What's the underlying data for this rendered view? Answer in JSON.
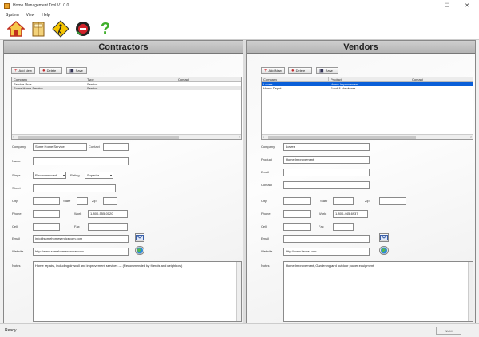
{
  "window": {
    "title": "Home Management Tool V1.0.0",
    "minimize": "–",
    "maximize": "☐",
    "close": "✕"
  },
  "menu": [
    "System",
    "View",
    "Help"
  ],
  "toolbar": {
    "icons": [
      "home-icon",
      "book-icon",
      "construction-sign-icon",
      "no-entry-icon",
      "help-icon"
    ],
    "help_glyph": "?"
  },
  "contractors": {
    "title": "Contractors",
    "buttons": {
      "add": "Add New",
      "delete": "Delete",
      "save": "Save"
    },
    "columns": [
      "Company",
      "Type",
      "Contact"
    ],
    "rows": [
      {
        "company": "Service Pros",
        "type": "Service",
        "contact": ""
      },
      {
        "company": "Some Home Service",
        "type": "Service",
        "contact": ""
      }
    ],
    "labels": {
      "company": "Company",
      "contact": "Contact",
      "name": "Name",
      "stage": "Stage",
      "rating": "Rating",
      "street": "Street",
      "city": "City",
      "state": "State",
      "zip": "Zip",
      "phone": "Phone",
      "work": "Work",
      "cell": "Cell",
      "fax": "Fax",
      "email": "Email",
      "website": "Website",
      "notes": "Notes"
    },
    "values": {
      "company": "Some Home Service",
      "contact": "",
      "name": "",
      "stage": "Recommended",
      "rating": "Superior",
      "street": "",
      "city": "",
      "state": "",
      "zip": "",
      "phone": "",
      "work": "1-800-555-0120",
      "cell": "",
      "fax": "",
      "email": "info@somehomeservicecom.com",
      "website": "http://www.somehomeservice.com",
      "notes": "Home repairs, including drywall and improvement services --- (Recommended by friends and neighbors)"
    }
  },
  "vendors": {
    "title": "Vendors",
    "buttons": {
      "add": "Add New",
      "delete": "Delete",
      "save": "Save"
    },
    "columns": [
      "Company",
      "Product",
      "Contact"
    ],
    "rows": [
      {
        "company": "Lowes",
        "product": "Home Improvement",
        "contact": ""
      },
      {
        "company": "Home Depot",
        "product": "Food & Hardware",
        "contact": ""
      }
    ],
    "labels": {
      "company": "Company",
      "product": "Product",
      "email": "Email",
      "contact": "Contact",
      "street": "Street",
      "city": "City",
      "state": "State",
      "zip": "Zip",
      "phone": "Phone",
      "work": "Work",
      "cell": "Cell",
      "fax": "Fax",
      "email2": "Email",
      "website": "Website",
      "notes": "Notes"
    },
    "values": {
      "company": "Lowes",
      "product": "Home Improvement",
      "email": "",
      "contact": "",
      "street": "",
      "city": "",
      "state": "",
      "zip": "",
      "phone": "",
      "work": "1-800-445-6937",
      "cell": "",
      "fax": "",
      "email2": "",
      "website": "http://www.lowes.com",
      "notes": "Home Improvement, Gardening and outdoor power equipment"
    }
  },
  "status": {
    "text": "Ready",
    "caps": "NUM"
  },
  "colors": {
    "selection": "#0a5fd8",
    "header": "#c4c4c4"
  }
}
